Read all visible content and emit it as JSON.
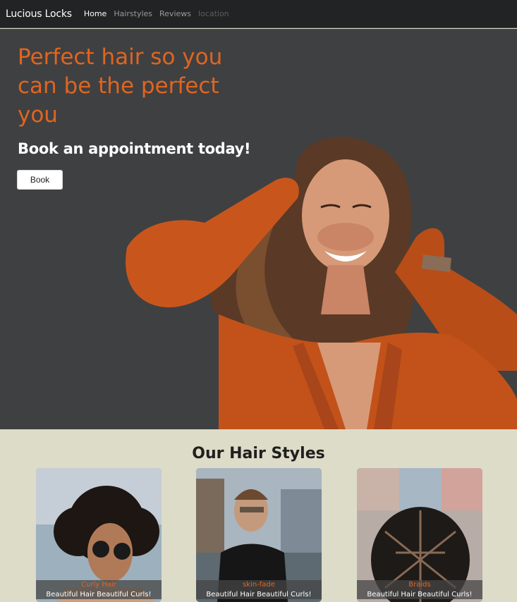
{
  "navbar": {
    "brand": "Lucious Locks",
    "links": [
      {
        "label": "Home",
        "state": "active"
      },
      {
        "label": "Hairstyles",
        "state": "normal"
      },
      {
        "label": "Reviews",
        "state": "normal"
      },
      {
        "label": "location",
        "state": "disabled"
      }
    ]
  },
  "hero": {
    "title": "Perfect hair so you can be the perfect you",
    "subtitle": "Book an appointment today!",
    "button_label": "Book",
    "accent_color": "#e0651f",
    "background_color": "#3f4042"
  },
  "styles_section": {
    "title": "Our Hair Styles",
    "cards": [
      {
        "title": "Curly Hair",
        "text": "Beautiful Hair Beautiful Curls!"
      },
      {
        "title": "skin-fade",
        "text": "Beautiful Hair Beautiful Curls!"
      },
      {
        "title": "Braids",
        "text": "Beautiful Hair Beautiful Curls!"
      }
    ]
  }
}
